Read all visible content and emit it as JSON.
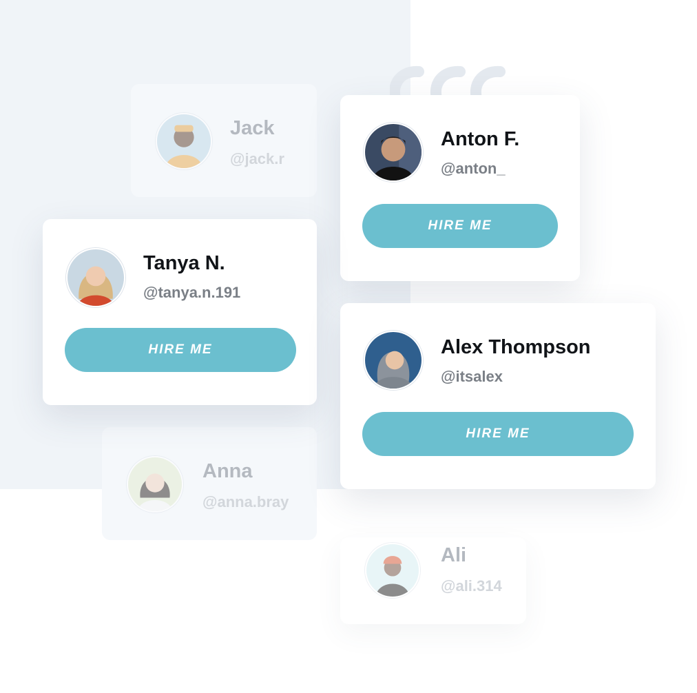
{
  "accent_color": "#6bbfcf",
  "quote_icon": "quote-icon",
  "profiles": {
    "jack": {
      "name": "Jack",
      "handle": "@jack.r"
    },
    "anton": {
      "name": "Anton F.",
      "handle": "@anton_",
      "button": "HIRE ME"
    },
    "tanya": {
      "name": "Tanya N.",
      "handle": "@tanya.n.191",
      "button": "HIRE ME"
    },
    "alex": {
      "name": "Alex Thompson",
      "handle": "@itsalex",
      "button": "HIRE ME"
    },
    "anna": {
      "name": "Anna",
      "handle": "@anna.bray"
    },
    "ali": {
      "name": "Ali",
      "handle": "@ali.314"
    }
  }
}
